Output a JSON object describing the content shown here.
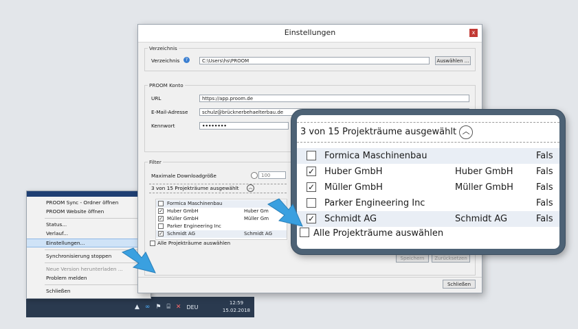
{
  "dialog": {
    "title": "Einstellungen",
    "close_label": "x",
    "directory_group": {
      "legend": "Verzeichnis",
      "label": "Verzeichnis",
      "value": "C:\\Users\\hs\\PROOM",
      "browse_button": "Auswählen ..."
    },
    "account_group": {
      "legend": "PROOM Konto",
      "url_label": "URL",
      "url_value": "https://app.proom.de",
      "email_label": "E-Mail-Adresse",
      "email_value": "schulz@brücknerbehaelterbau.de",
      "password_label": "Kennwort",
      "password_value": "••••••••"
    },
    "filter_group": {
      "legend": "Filter",
      "max_download_label": "Maximale Downloadgröße",
      "max_download_value": "100",
      "projects_selected": "3 von 15 Projekträume ausgewählt",
      "select_all_label": "Alle Projekträume auswählen",
      "rows": [
        {
          "checked": false,
          "name": "Formica Maschinenbau",
          "company": ""
        },
        {
          "checked": true,
          "name": "Huber GmbH",
          "company": "Huber Gm"
        },
        {
          "checked": true,
          "name": "Müller GmbH",
          "company": "Müller Gm"
        },
        {
          "checked": false,
          "name": "Parker Engineering Inc",
          "company": ""
        },
        {
          "checked": true,
          "name": "Schmidt AG",
          "company": "Schmidt AG"
        }
      ]
    },
    "save_button": "Speichern",
    "reset_button": "Zurücksetzen",
    "close_button": "Schließen"
  },
  "zoom": {
    "header": "3 von 15 Projekträume ausgewählt",
    "rows": [
      {
        "checked": false,
        "name": "Formica Maschinenbau",
        "company": "",
        "flag": "Fals"
      },
      {
        "checked": true,
        "name": "Huber GmbH",
        "company": "Huber GmbH",
        "flag": "Fals"
      },
      {
        "checked": true,
        "name": "Müller GmbH",
        "company": "Müller GmbH",
        "flag": "Fals"
      },
      {
        "checked": false,
        "name": "Parker Engineering Inc",
        "company": "",
        "flag": "Fals"
      },
      {
        "checked": true,
        "name": "Schmidt AG",
        "company": "Schmidt AG",
        "flag": "Fals"
      }
    ],
    "select_all_label": "Alle Projekträume auswählen"
  },
  "context_menu": {
    "items": [
      {
        "label": "PROOM Sync - Ordner öffnen",
        "state": "normal"
      },
      {
        "label": "PROOM Website öffnen",
        "state": "normal"
      },
      {
        "label": "Status...",
        "state": "normal"
      },
      {
        "label": "Verlauf...",
        "state": "normal"
      },
      {
        "label": "Einstellungen...",
        "state": "highlighted"
      },
      {
        "label": "Synchronisierung stoppen",
        "state": "normal"
      },
      {
        "label": "Neue Version herunterladen ...",
        "state": "disabled"
      },
      {
        "label": "Problem melden",
        "state": "normal"
      },
      {
        "label": "Schließen",
        "state": "normal"
      }
    ]
  },
  "taskbar": {
    "language": "DEU",
    "time": "12:59",
    "date": "15.02.2018"
  },
  "colors": {
    "accent": "#1f3f73",
    "highlight": "#cfe3f7",
    "close": "#c23a35",
    "arrow": "#3aa0e0",
    "zoom_border": "#4d6275"
  }
}
